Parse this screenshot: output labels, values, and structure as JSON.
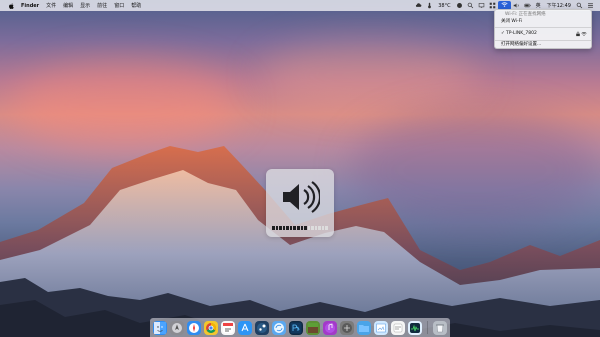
{
  "menubar": {
    "app_name": "Finder",
    "items": [
      "文件",
      "编辑",
      "显示",
      "前往",
      "窗口",
      "帮助"
    ],
    "temperature": "38°C",
    "input_method": "英",
    "date_time": "下午12:49"
  },
  "wifi_menu": {
    "status": "Wi-Fi: 正在查找网络",
    "turn_off": "关闭 Wi-Fi",
    "network_name": "TP-LINK_7802",
    "preferences": "打开网络偏好设置..."
  },
  "hud": {
    "volume_level": 0.6,
    "segments": 16
  },
  "dock": {
    "icons": [
      {
        "name": "finder-icon",
        "bg": "#2e8df2"
      },
      {
        "name": "launchpad-icon",
        "bg": "#8b8b91"
      },
      {
        "name": "safari-icon",
        "bg": "#2f8cf0"
      },
      {
        "name": "chrome-icon",
        "bg": "#f3c72d"
      },
      {
        "name": "calendar-icon",
        "bg": "#f7f7f7"
      },
      {
        "name": "app-store-icon",
        "bg": "#2d95f6"
      },
      {
        "name": "steam-icon",
        "bg": "#1f3f62"
      },
      {
        "name": "sync-icon",
        "bg": "#5aa8f0"
      },
      {
        "name": "photoshop-icon",
        "bg": "#0f2941"
      },
      {
        "name": "minecraft-icon",
        "bg": "#5d8f35"
      },
      {
        "name": "music-icon",
        "bg": "#a33ac8"
      },
      {
        "name": "game-icon",
        "bg": "#7b7b7b"
      },
      {
        "name": "folder-icon",
        "bg": "#4aa4e8"
      },
      {
        "name": "preview-icon",
        "bg": "#cfe8ff"
      },
      {
        "name": "dashboard-icon",
        "bg": "#f5f5f5"
      },
      {
        "name": "activity-monitor-icon",
        "bg": "#e0f0ff"
      },
      {
        "name": "trash-icon",
        "bg": "#b8bec6"
      }
    ]
  }
}
